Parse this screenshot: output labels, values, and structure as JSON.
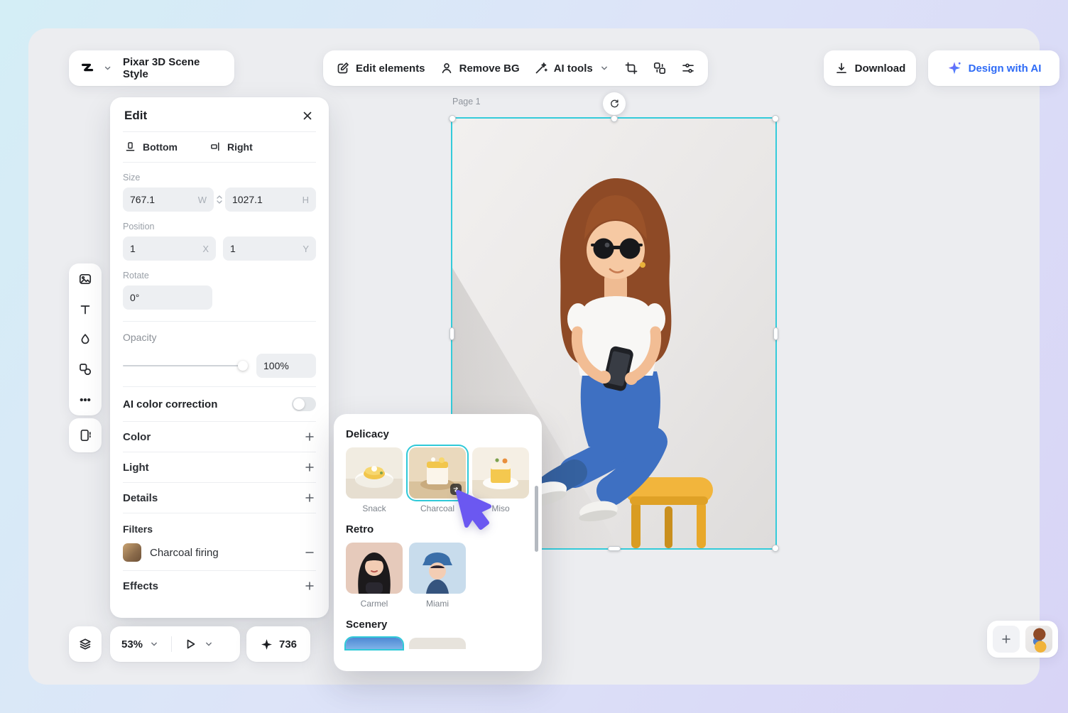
{
  "theme": {
    "selection_accent": "#34cbda",
    "brand_blue": "#2e6bf6",
    "cursor_purple": "#6b58f1",
    "stool_yellow": "#f2b53c"
  },
  "header": {
    "style_name": "Pixar 3D Scene Style",
    "edit_elements": "Edit elements",
    "remove_bg": "Remove BG",
    "ai_tools": "AI tools",
    "download": "Download",
    "design_with_ai": "Design with AI"
  },
  "canvas": {
    "page_label": "Page 1"
  },
  "edit_panel": {
    "title": "Edit",
    "align_bottom": "Bottom",
    "align_right": "Right",
    "size": {
      "label": "Size",
      "w_value": "767.1",
      "w_unit": "W",
      "h_value": "1027.1",
      "h_unit": "H"
    },
    "position": {
      "label": "Position",
      "x_value": "1",
      "x_unit": "X",
      "y_value": "1",
      "y_unit": "Y"
    },
    "rotate": {
      "label": "Rotate",
      "value": "0°"
    },
    "opacity": {
      "label": "Opacity",
      "value": "100%"
    },
    "ai_color_correction": "AI color correction",
    "rows": {
      "color": "Color",
      "light": "Light",
      "details": "Details",
      "filters": "Filters",
      "effects": "Effects"
    },
    "active_filter": "Charcoal firing"
  },
  "footer": {
    "zoom": "53%",
    "credits": "736"
  },
  "filters_popup": {
    "sections": [
      {
        "title": "Delicacy",
        "items": [
          {
            "name": "Snack",
            "selected": false
          },
          {
            "name": "Charcoal",
            "selected": true
          },
          {
            "name": "Miso",
            "selected": false
          }
        ]
      },
      {
        "title": "Retro",
        "items": [
          {
            "name": "Carmel",
            "selected": false
          },
          {
            "name": "Miami",
            "selected": false
          }
        ]
      },
      {
        "title": "Scenery",
        "items": []
      }
    ]
  }
}
